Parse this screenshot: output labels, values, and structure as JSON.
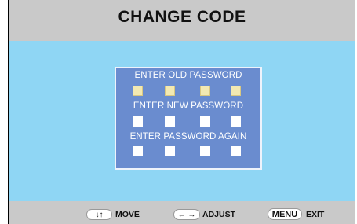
{
  "title": "CHANGE CODE",
  "panel": {
    "old_password_label": "ENTER OLD PASSWORD",
    "new_password_label": "ENTER NEW PASSWORD",
    "again_password_label": "ENTER PASSWORD AGAIN"
  },
  "footer": {
    "move_key": "↓↑",
    "move_label": "MOVE",
    "adjust_key": "← →",
    "adjust_label": "ADJUST",
    "menu_key": "MENU",
    "exit_label": "EXIT"
  },
  "colors": {
    "title_bar": "#c9c9c9",
    "background": "#8fd6f4",
    "panel": "#6a8ccf",
    "filled_slot": "#f3e9b2"
  }
}
